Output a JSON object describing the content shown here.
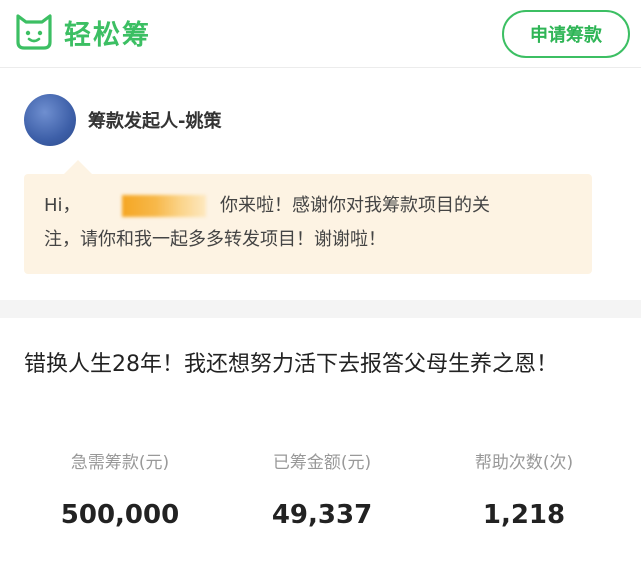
{
  "header": {
    "app_name": "轻松筹",
    "apply_button": "申请筹款",
    "brand_color": "#3cbf63"
  },
  "organizer": {
    "name": "筹款发起人-姚策",
    "avatar_icon": "avatar-icon"
  },
  "message": {
    "greeting": "Hi，",
    "line1": "你来啦！感谢你对我筹款项目的关",
    "line2": "注，请你和我一起多多转发项目！谢谢啦！",
    "bubble_color": "#fdf3e3"
  },
  "campaign": {
    "title": "错换人生28年！我还想努力活下去报答父母生养之恩！"
  },
  "stats": [
    {
      "label": "急需筹款(元)",
      "value": "500,000"
    },
    {
      "label": "已筹金额(元)",
      "value": "49,337"
    },
    {
      "label": "帮助次数(次)",
      "value": "1,218"
    }
  ]
}
